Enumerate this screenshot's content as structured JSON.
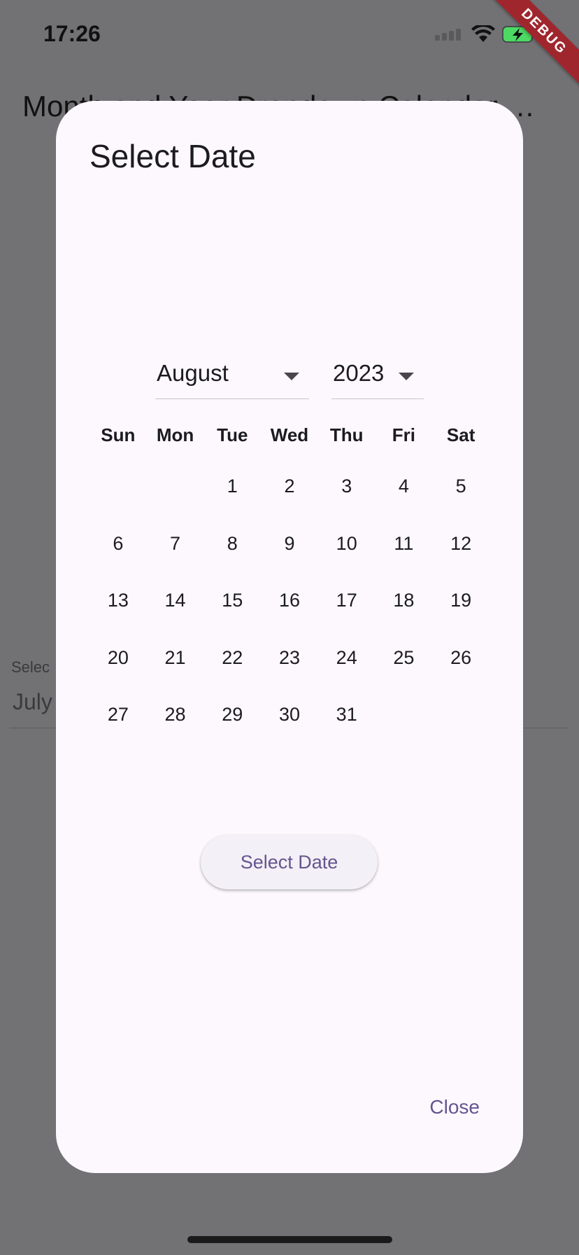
{
  "status_bar": {
    "time": "17:26",
    "debug_label": "DEBUG",
    "icons": [
      "signal-icon",
      "wifi-icon",
      "battery-charging-icon"
    ],
    "battery_color": "#4cd964"
  },
  "app": {
    "title": "Month and Year Dropdown Calendar Ex...",
    "field_label": "Selec",
    "field_value": "July"
  },
  "dialog": {
    "title": "Select Date",
    "month": "August",
    "year": "2023",
    "weekdays": [
      "Sun",
      "Mon",
      "Tue",
      "Wed",
      "Thu",
      "Fri",
      "Sat"
    ],
    "days": [
      "",
      "",
      "1",
      "2",
      "3",
      "4",
      "5",
      "6",
      "7",
      "8",
      "9",
      "10",
      "11",
      "12",
      "13",
      "14",
      "15",
      "16",
      "17",
      "18",
      "19",
      "20",
      "21",
      "22",
      "23",
      "24",
      "25",
      "26",
      "27",
      "28",
      "29",
      "30",
      "31",
      "",
      ""
    ],
    "select_button": "Select Date",
    "close_button": "Close",
    "accent_color": "#65558f"
  }
}
